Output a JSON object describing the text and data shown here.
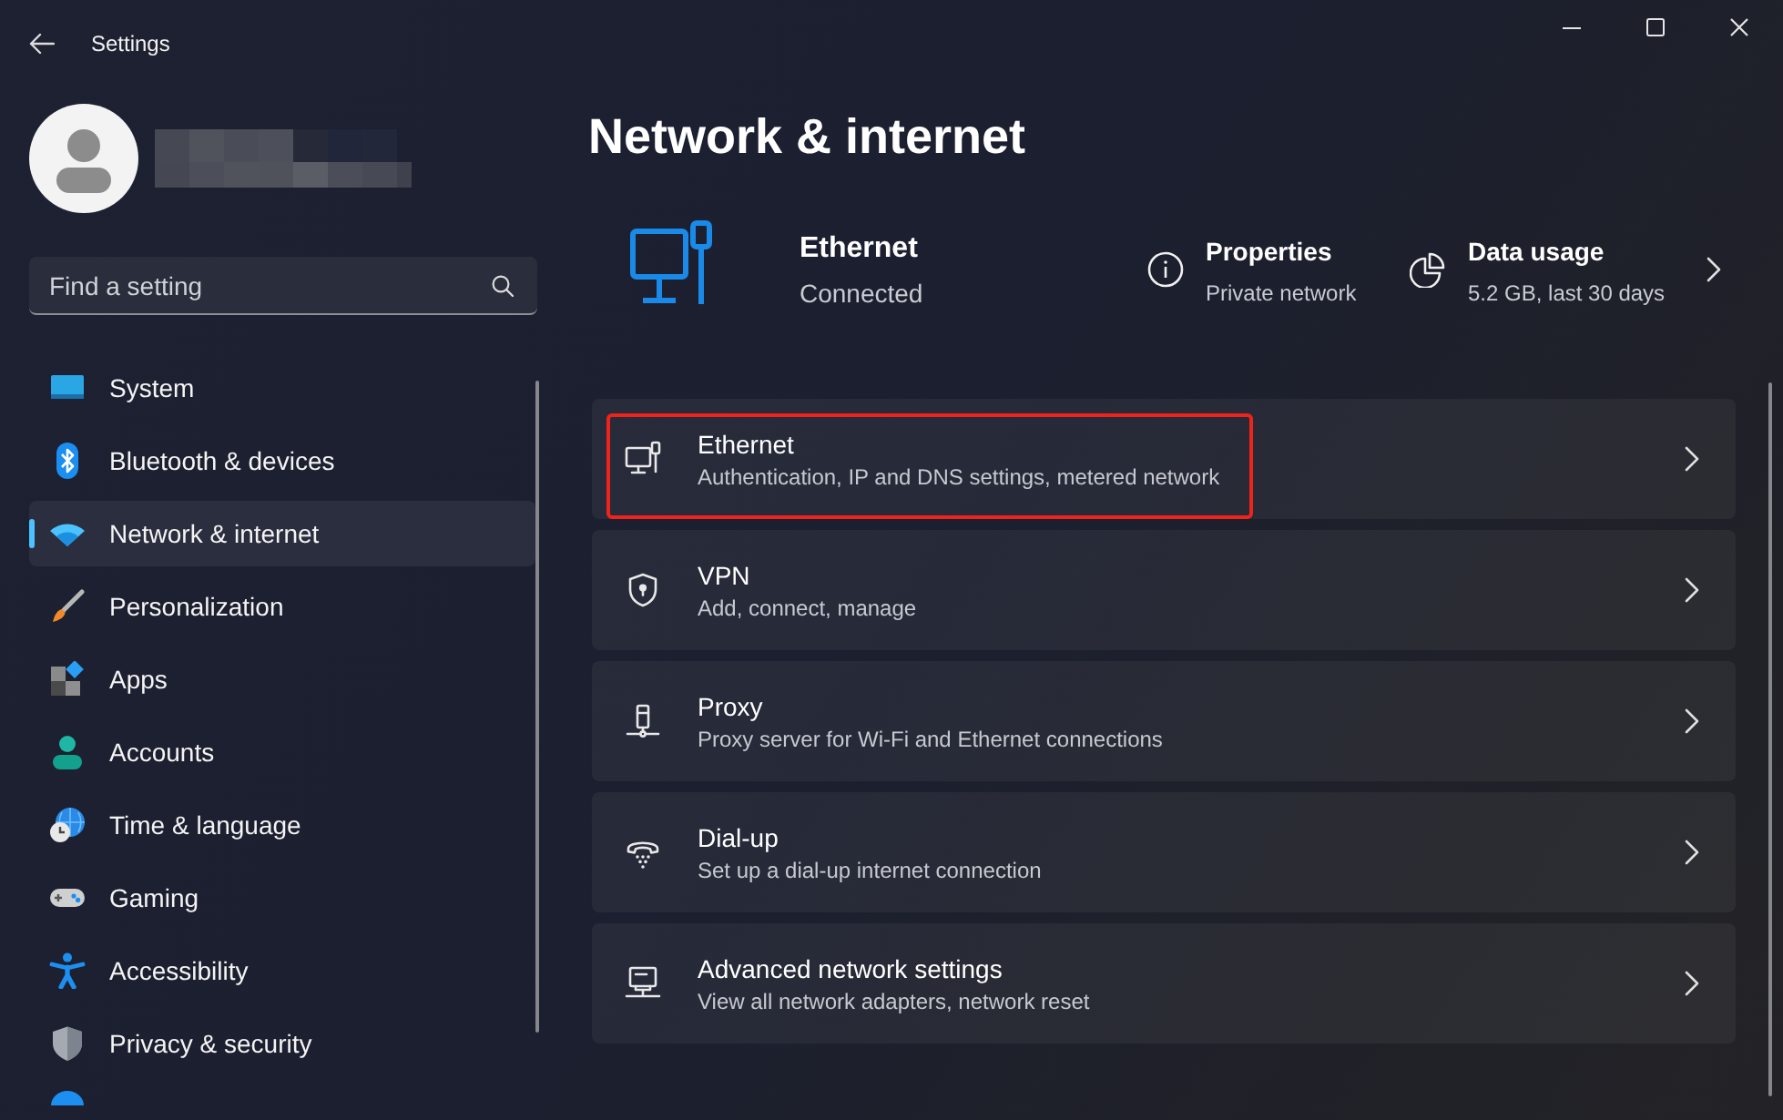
{
  "window": {
    "title": "Settings"
  },
  "search": {
    "placeholder": "Find a setting"
  },
  "sidebar": {
    "items": [
      {
        "label": "System",
        "selected": false
      },
      {
        "label": "Bluetooth & devices",
        "selected": false
      },
      {
        "label": "Network & internet",
        "selected": true
      },
      {
        "label": "Personalization",
        "selected": false
      },
      {
        "label": "Apps",
        "selected": false
      },
      {
        "label": "Accounts",
        "selected": false
      },
      {
        "label": "Time & language",
        "selected": false
      },
      {
        "label": "Gaming",
        "selected": false
      },
      {
        "label": "Accessibility",
        "selected": false
      },
      {
        "label": "Privacy & security",
        "selected": false
      }
    ]
  },
  "page": {
    "title": "Network & internet"
  },
  "status": {
    "connection": {
      "title": "Ethernet",
      "status": "Connected"
    },
    "properties": {
      "title": "Properties",
      "detail": "Private network"
    },
    "data_usage": {
      "title": "Data usage",
      "detail": "5.2 GB, last 30 days"
    }
  },
  "settings_list": [
    {
      "title": "Ethernet",
      "subtitle": "Authentication, IP and DNS settings, metered network",
      "highlighted": true
    },
    {
      "title": "VPN",
      "subtitle": "Add, connect, manage",
      "highlighted": false
    },
    {
      "title": "Proxy",
      "subtitle": "Proxy server for Wi-Fi and Ethernet connections",
      "highlighted": false
    },
    {
      "title": "Dial-up",
      "subtitle": "Set up a dial-up internet connection",
      "highlighted": false
    },
    {
      "title": "Advanced network settings",
      "subtitle": "View all network adapters, network reset",
      "highlighted": false
    }
  ]
}
